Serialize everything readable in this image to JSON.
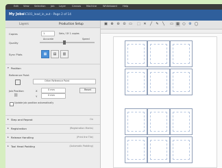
{
  "menubar": [
    "Edit",
    "View",
    "Selection",
    "Job",
    "Layer",
    "Canvas",
    "Machine",
    "Whiteboard",
    "Help"
  ],
  "title": {
    "app": "My Jobs",
    "file": "RC101_lead_in_out - Page 2 of 14"
  },
  "tabs": [
    "Layers",
    "Production Setup"
  ],
  "copies": {
    "label": "Copies",
    "value": "1",
    "note": "Sets / Of 1 copies"
  },
  "quality": {
    "label": "Quality",
    "left": "Accurate",
    "right": "Speed"
  },
  "sync": {
    "label": "Sync Plots"
  },
  "position": {
    "label": "Position",
    "ref_label": "Reference Point",
    "ref_value": "Other Reference Point",
    "job_label": "Job Position",
    "x_label": "X",
    "x_value": "0 mm",
    "y_label": "Y",
    "y_value": "0 mm",
    "reset": "Reset",
    "auto": "Update job position automatically"
  },
  "sections": [
    {
      "name": "Step and Repeat",
      "value": "On"
    },
    {
      "name": "Registration",
      "value": "(Registration Marks)"
    },
    {
      "name": "Release Handling",
      "value": "(Print the Tile)"
    },
    {
      "name": "Tool Head Padding",
      "value": "(Automatic Padding)"
    }
  ]
}
